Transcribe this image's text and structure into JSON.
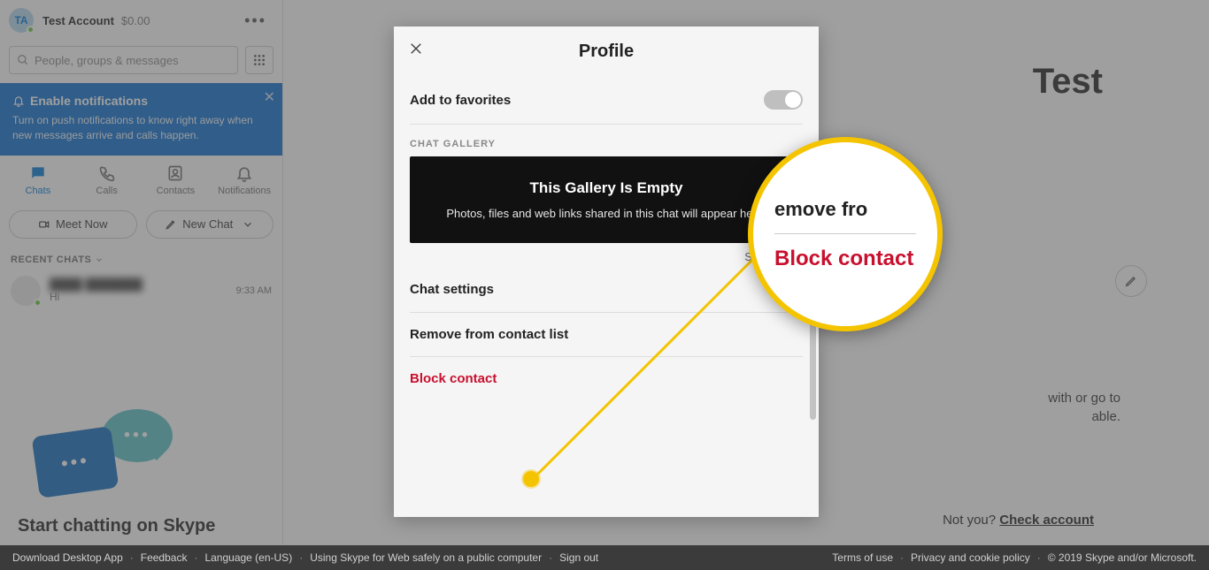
{
  "sidebar": {
    "avatar_initials": "TA",
    "account_name": "Test Account",
    "account_balance": "$0.00",
    "search_placeholder": "People, groups & messages",
    "notif_title": "Enable notifications",
    "notif_desc": "Turn on push notifications to know right away when new messages arrive and calls happen.",
    "nav": {
      "chats": "Chats",
      "calls": "Calls",
      "contacts": "Contacts",
      "notifications": "Notifications"
    },
    "meet_now": "Meet Now",
    "new_chat": "New Chat",
    "recent_label": "RECENT CHATS",
    "chat": {
      "name": "████ ███████",
      "preview": "Hi",
      "time": "9:33 AM"
    },
    "promo_title": "Start chatting on Skype"
  },
  "main": {
    "title_fragment": "Test",
    "hint_line1": "with or go to",
    "hint_line2": "able.",
    "not_you": "Not you?",
    "check_account": "Check account"
  },
  "modal": {
    "title": "Profile",
    "add_favorites": "Add to favorites",
    "chat_gallery_label": "CHAT GALLERY",
    "gallery_title": "This Gallery Is Empty",
    "gallery_desc": "Photos, files and web links shared in this chat will appear here.",
    "show_more": "Show more",
    "chat_settings": "Chat settings",
    "remove_contact": "Remove from contact list",
    "block_contact": "Block contact"
  },
  "magnifier": {
    "top_text": "emove fro",
    "main_text": "Block contact"
  },
  "footer": {
    "download": "Download Desktop App",
    "feedback": "Feedback",
    "language": "Language (en-US)",
    "safely": "Using Skype for Web safely on a public computer",
    "signout": "Sign out",
    "terms": "Terms of use",
    "privacy": "Privacy and cookie policy",
    "copyright": "© 2019 Skype and/or Microsoft."
  }
}
